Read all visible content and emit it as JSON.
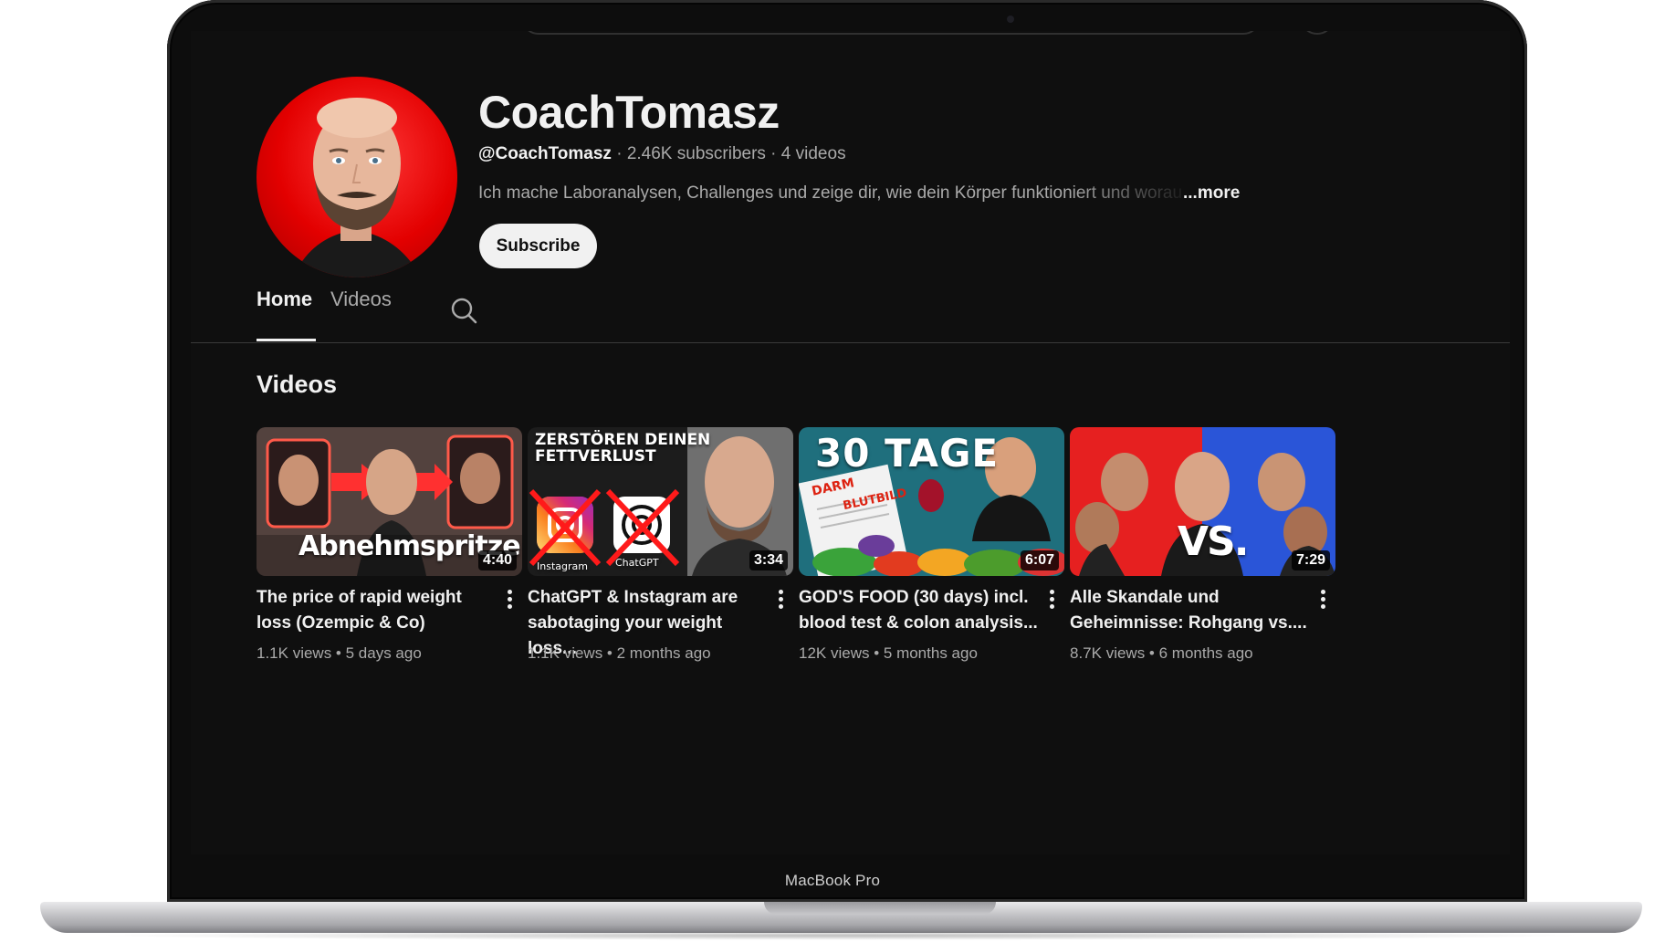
{
  "device": {
    "label": "MacBook Pro"
  },
  "channel": {
    "name": "CoachTomasz",
    "handle": "@CoachTomasz",
    "subscribers": "2.46K subscribers",
    "videos_count": "4 videos",
    "separator": " · ",
    "description": "Ich mache Laboranalysen, Challenges und zeige dir, wie dein Körper funktioniert und worauf",
    "more_label": "...more",
    "subscribe_label": "Subscribe"
  },
  "tabs": [
    {
      "label": "Home",
      "active": true
    },
    {
      "label": "Videos",
      "active": false
    }
  ],
  "section": {
    "title": "Videos"
  },
  "videos": [
    {
      "title": "The price of rapid weight loss (Ozempic & Co)",
      "views": "1.1K views",
      "age": "5 days ago",
      "duration": "4:40",
      "thumb_text": "Abnehmspritze"
    },
    {
      "title": "ChatGPT & Instagram are sabotaging your weight loss...",
      "views": "1.1K views",
      "age": "2 months ago",
      "duration": "3:34",
      "thumb_text_1": "ZERSTÖREN DEINEN",
      "thumb_text_2": "FETTVERLUST",
      "thumb_label_1": "Instagram",
      "thumb_label_2": "ChatGPT"
    },
    {
      "title": "GOD'S FOOD (30 days) incl. blood test & colon analysis...",
      "views": "12K views",
      "age": "5 months ago",
      "duration": "6:07",
      "thumb_text": "30 TAGE",
      "thumb_text_2": "DARM",
      "thumb_text_3": "BLUTBILD"
    },
    {
      "title": "Alle Skandale und Geheimnisse: Rohgang vs....",
      "views": "8.7K views",
      "age": "6 months ago",
      "duration": "7:29",
      "thumb_text": "VS."
    }
  ],
  "stats_separator": " • ",
  "colors": {
    "background": "#0f0f0f",
    "text_primary": "#f1f1f1",
    "text_secondary": "#aaaaaa",
    "accent_red": "#e30000"
  }
}
